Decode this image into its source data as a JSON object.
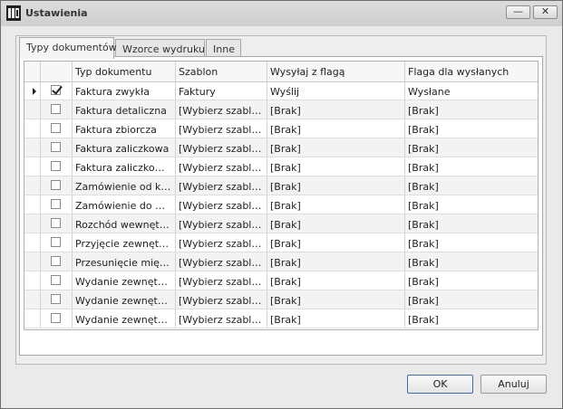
{
  "window": {
    "title": "Ustawienia",
    "minimize": "—",
    "close": "✕"
  },
  "tabs": [
    {
      "label": "Typy dokumentów",
      "active": true
    },
    {
      "label": "Wzorce wydruku",
      "active": false
    },
    {
      "label": "Inne",
      "active": false
    }
  ],
  "grid": {
    "columns": [
      "Typ dokumentu",
      "Szablon",
      "Wysyłaj z flagą",
      "Flaga dla wysłanych"
    ],
    "rows": [
      {
        "checked": true,
        "current": true,
        "typ": "Faktura zwykła",
        "szablon": "Faktury",
        "wysylaj": "Wyślij",
        "flaga": "Wysłane"
      },
      {
        "checked": false,
        "current": false,
        "typ": "Faktura detaliczna",
        "szablon": "[Wybierz szablon]",
        "wysylaj": "[Brak]",
        "flaga": "[Brak]"
      },
      {
        "checked": false,
        "current": false,
        "typ": "Faktura zbiorcza",
        "szablon": "[Wybierz szablon]",
        "wysylaj": "[Brak]",
        "flaga": "[Brak]"
      },
      {
        "checked": false,
        "current": false,
        "typ": "Faktura zaliczkowa",
        "szablon": "[Wybierz szablon]",
        "wysylaj": "[Brak]",
        "flaga": "[Brak]"
      },
      {
        "checked": false,
        "current": false,
        "typ": "Faktura zaliczkowa ...",
        "szablon": "[Wybierz szablon]",
        "wysylaj": "[Brak]",
        "flaga": "[Brak]"
      },
      {
        "checked": false,
        "current": false,
        "typ": "Zamówienie od klienta",
        "szablon": "[Wybierz szablon]",
        "wysylaj": "[Brak]",
        "flaga": "[Brak]"
      },
      {
        "checked": false,
        "current": false,
        "typ": "Zamówienie do dost...",
        "szablon": "[Wybierz szablon]",
        "wysylaj": "[Brak]",
        "flaga": "[Brak]"
      },
      {
        "checked": false,
        "current": false,
        "typ": "Rozchód wewnętrzny",
        "szablon": "[Wybierz szablon]",
        "wysylaj": "[Brak]",
        "flaga": "[Brak]"
      },
      {
        "checked": false,
        "current": false,
        "typ": "Przyjęcie zewnętrzne",
        "szablon": "[Wybierz szablon]",
        "wysylaj": "[Brak]",
        "flaga": "[Brak]"
      },
      {
        "checked": false,
        "current": false,
        "typ": "Przesunięcie między...",
        "szablon": "[Wybierz szablon]",
        "wysylaj": "[Brak]",
        "flaga": "[Brak]"
      },
      {
        "checked": false,
        "current": false,
        "typ": "Wydanie zewnętrzne",
        "szablon": "[Wybierz szablon]",
        "wysylaj": "[Brak]",
        "flaga": "[Brak]"
      },
      {
        "checked": false,
        "current": false,
        "typ": "Wydanie zewnętrzn...",
        "szablon": "[Wybierz szablon]",
        "wysylaj": "[Brak]",
        "flaga": "[Brak]"
      },
      {
        "checked": false,
        "current": false,
        "typ": "Wydanie zewnętrzn...",
        "szablon": "[Wybierz szablon]",
        "wysylaj": "[Brak]",
        "flaga": "[Brak]"
      }
    ]
  },
  "buttons": {
    "ok": "OK",
    "cancel": "Anuluj"
  },
  "colors": {
    "primary_border": "#3c6fb0",
    "alt_row": "#f3f3f3"
  }
}
